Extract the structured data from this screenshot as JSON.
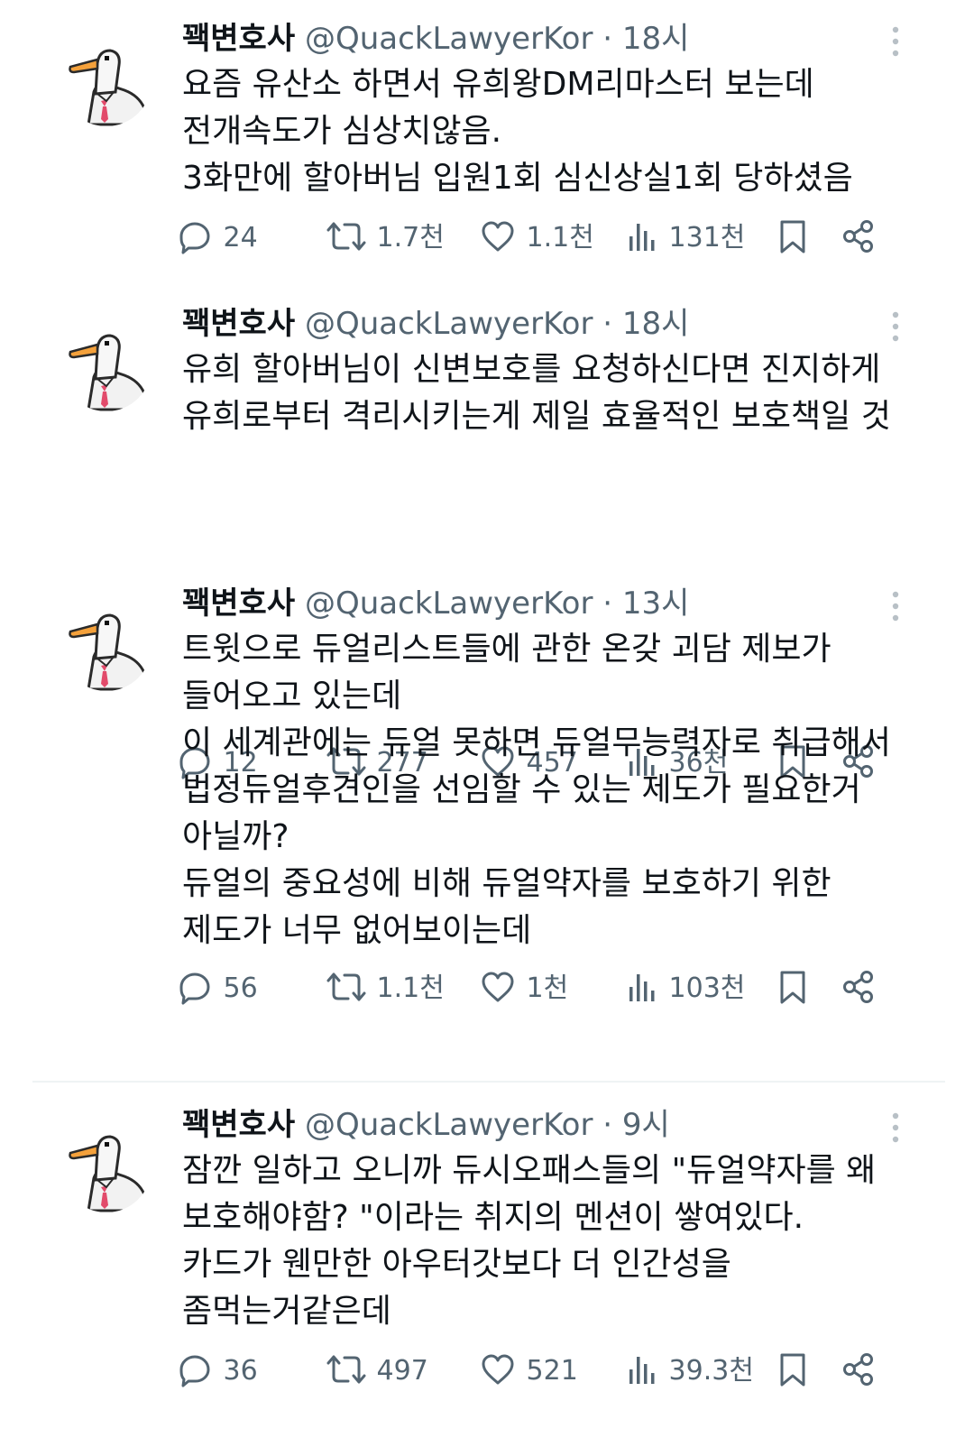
{
  "colors": {
    "text_primary": "#0f1419",
    "text_secondary": "#536471",
    "divider": "#eff3f4"
  },
  "icons": {
    "reply": "reply-icon",
    "retweet": "retweet-icon",
    "like": "heart-icon",
    "views": "views-icon",
    "bookmark": "bookmark-icon",
    "share": "share-icon",
    "more": "more-icon"
  },
  "tweets": [
    {
      "name": "꽥변호사",
      "handle": "@QuackLawyerKor",
      "dot": "·",
      "time": "18시",
      "lines": [
        "요즘 유산소 하면서 유희왕DM리마스터 보는데",
        "전개속도가 심상치않음.",
        "3화만에 할아버님 입원1회 심신상실1회 당하셨음"
      ],
      "replies": "24",
      "retweets": "1.7천",
      "likes": "1.1천",
      "views": "131천"
    },
    {
      "name": "꽥변호사",
      "handle": "@QuackLawyerKor",
      "dot": "·",
      "time": "18시",
      "lines": [
        "유희 할아버님이 신변보호를 요청하신다면 진지하게",
        "유희로부터 격리시키는게 제일 효율적인 보호책일 것"
      ],
      "replies": "12",
      "retweets": "277",
      "likes": "457",
      "views": "36천"
    },
    {
      "name": "꽥변호사",
      "handle": "@QuackLawyerKor",
      "dot": "·",
      "time": "13시",
      "lines": [
        "트윗으로 듀얼리스트들에 관한 온갖 괴담 제보가",
        "들어오고 있는데",
        "이 세계관에는 듀얼 못하면 듀얼무능력자로 취급해서",
        "법정듀얼후견인을 선임할 수 있는 제도가 필요한거",
        "아닐까?",
        "듀얼의 중요성에 비해 듀얼약자를 보호하기 위한",
        "제도가 너무 없어보이는데"
      ],
      "replies": "56",
      "retweets": "1.1천",
      "likes": "1천",
      "views": "103천"
    },
    {
      "name": "꽥변호사",
      "handle": "@QuackLawyerKor",
      "dot": "·",
      "time": "9시",
      "lines": [
        "잠깐 일하고 오니까 듀시오패스들의 \"듀얼약자를 왜",
        "보호해야함? \"이라는 취지의 멘션이 쌓여있다.",
        "카드가 웬만한 아우터갓보다 더 인간성을",
        "좀먹는거같은데"
      ],
      "replies": "36",
      "retweets": "497",
      "likes": "521",
      "views": "39.3천"
    }
  ]
}
